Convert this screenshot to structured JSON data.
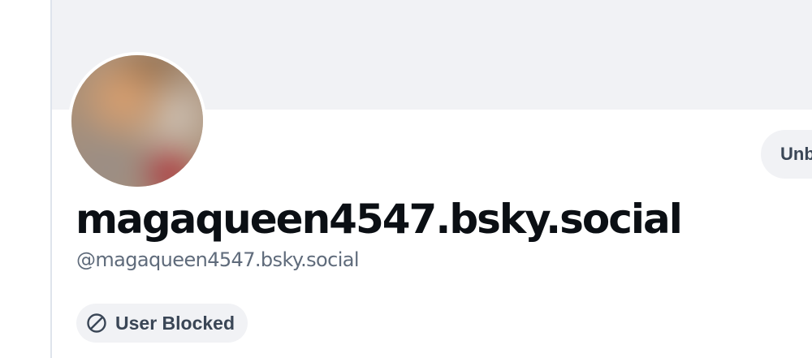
{
  "profile": {
    "display_name": "magaqueen4547.bsky.social",
    "handle": "@magaqueen4547.bsky.social",
    "blocked_label": "User Blocked",
    "blocked_icon": "block-icon",
    "unblock_label": "Unb"
  },
  "colors": {
    "banner": "#f1f2f5",
    "text_primary": "#0b0f14",
    "text_secondary": "#5f6b7b",
    "pill_text": "#3a4656"
  }
}
